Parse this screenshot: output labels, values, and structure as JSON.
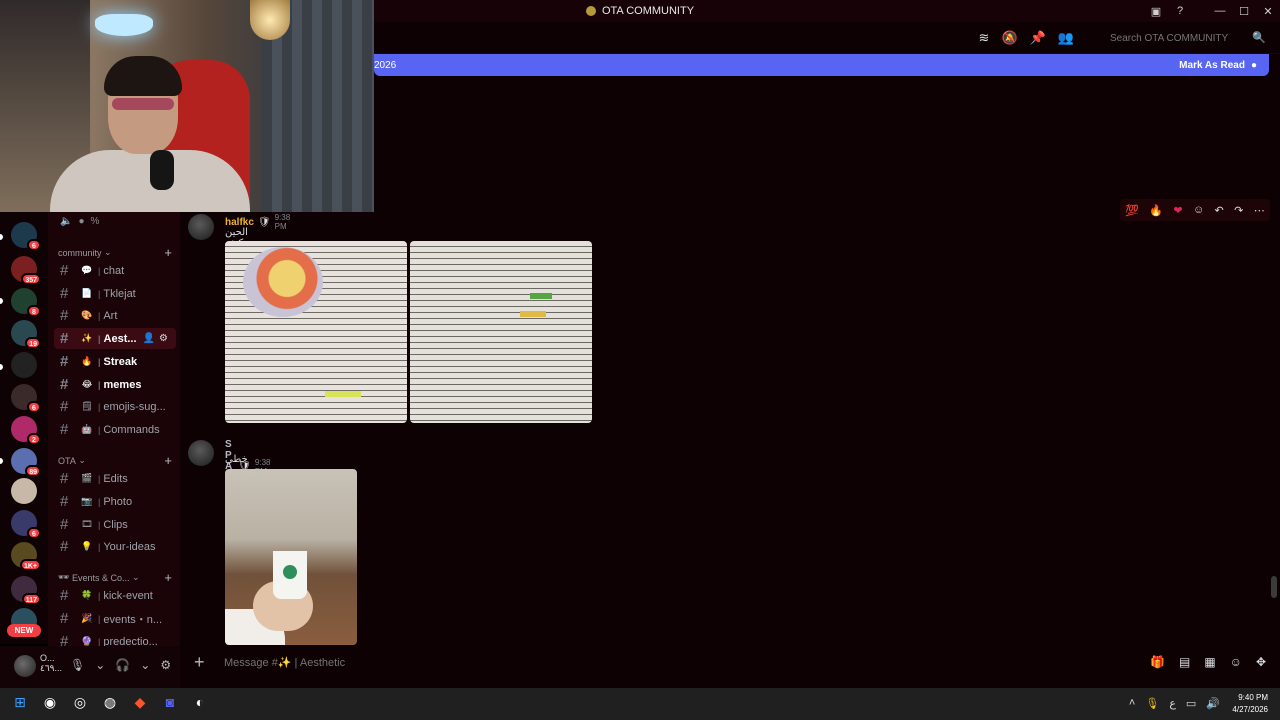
{
  "window": {
    "title": "OTA COMMUNITY"
  },
  "header": {
    "search_placeholder": "Search OTA COMMUNITY",
    "new_messages_text": "2026",
    "mark_as_read": "Mark As Read"
  },
  "server_badges": [
    "6",
    "357",
    "8",
    "19",
    "6",
    "2",
    "89",
    "6",
    "1K+",
    "117"
  ],
  "new_badge": "NEW",
  "voice_row": {
    "icon": "speaker-icon",
    "text": "%"
  },
  "categories": [
    {
      "label": "community"
    },
    {
      "label": "OTA"
    },
    {
      "label": "Events & Co..."
    }
  ],
  "channels_community": [
    {
      "emoji": "💬",
      "name": "chat"
    },
    {
      "emoji": "📄",
      "name": "Tklejat"
    },
    {
      "emoji": "🎨",
      "name": "Art"
    },
    {
      "emoji": "✨",
      "name": "Aest..."
    },
    {
      "emoji": "🔥",
      "name": "Streak"
    },
    {
      "emoji": "😂",
      "name": "memes"
    },
    {
      "emoji": "🗒",
      "name": "emojis-sug..."
    },
    {
      "emoji": "🤖",
      "name": "Commands"
    }
  ],
  "channels_ota": [
    {
      "emoji": "🎬",
      "name": "Edits"
    },
    {
      "emoji": "📷",
      "name": "Photo"
    },
    {
      "emoji": "🎞",
      "name": "Clips"
    },
    {
      "emoji": "💡",
      "name": "Your-ideas"
    }
  ],
  "channels_events": [
    {
      "emoji": "🍀",
      "name": "kick-event"
    },
    {
      "emoji": "🎉",
      "name": "events・n..."
    },
    {
      "emoji": "🔮",
      "name": "predectio..."
    }
  ],
  "user": {
    "name": "O...",
    "status": "٤٦٩..."
  },
  "messages": [
    {
      "author": "halfkc",
      "badge": "🛡",
      "time": "9:38 PM",
      "text": "الحين كيف بقراه كله من السياق الي نسويه من تخلص اسرع"
    },
    {
      "author": "S P A C E",
      "badge": "🛡",
      "time": "9:38 PM",
      "text": "خطي"
    }
  ],
  "message_tools": [
    "💯",
    "🔥",
    "❤",
    "☺",
    "↶",
    "↷",
    "⋯"
  ],
  "composer": {
    "placeholder": "Message #✨ | Aesthetic"
  },
  "taskbar": {
    "time": "9:40 PM",
    "date": "4/27/2026",
    "lang": "ع"
  },
  "colors": {
    "accent": "#5865f2",
    "background": "#0d0104",
    "sidebar": "#1a0408",
    "badge_red": "#f23f43",
    "author_gold": "#f0b232"
  }
}
